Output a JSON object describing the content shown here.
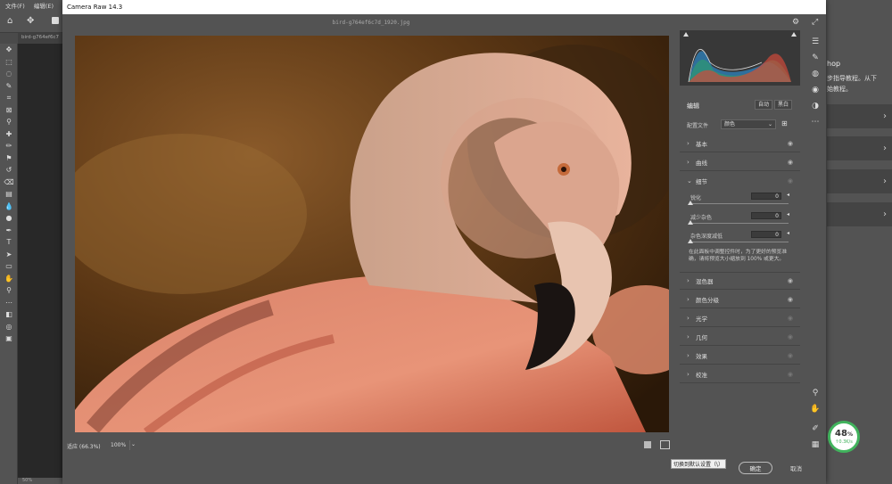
{
  "ps": {
    "menu": [
      "文件(F)",
      "编辑(E)"
    ],
    "tab_title": "bird-g764ef6c7",
    "status_zoom": "50%",
    "right_panel": {
      "title": "hop",
      "line1": "步指导教程。从下",
      "line2": "始教程。"
    }
  },
  "window": {
    "title": "Camera Raw 14.3",
    "filename": "bird-g764ef6c7d_1920.jpg"
  },
  "bottombar": {
    "fit_label": "适应 (66.3%)",
    "zoom_value": "100%"
  },
  "panel": {
    "edit_label": "编辑",
    "auto_label": "自动",
    "bw_label": "黑白",
    "profile_label": "配置文件",
    "profile_value": "颜色",
    "sections": [
      {
        "label": "基本",
        "expanded": false
      },
      {
        "label": "曲线",
        "expanded": false
      },
      {
        "label": "细节",
        "expanded": true
      },
      {
        "label": "混色器",
        "expanded": false
      },
      {
        "label": "颜色分级",
        "expanded": false
      },
      {
        "label": "光学",
        "expanded": false
      },
      {
        "label": "几何",
        "expanded": false
      },
      {
        "label": "效果",
        "expanded": false
      },
      {
        "label": "校准",
        "expanded": false
      }
    ],
    "detail": {
      "sharpen_label": "锐化",
      "sharpen_value": "0",
      "noise_label": "减少杂色",
      "noise_value": "0",
      "color_noise_label": "杂色深度减低",
      "color_noise_value": "0",
      "hint": "在此面板中调整控件时，为了更好的预览准确，请将预览大小缩放到 100% 或更大。"
    }
  },
  "footer": {
    "tooltip": "切换到默认设置（\\）",
    "ok_label": "确定",
    "cancel_label": "取消"
  },
  "zoom_badge": {
    "percent": "48",
    "unit": "%",
    "speed": "0.3K/s"
  },
  "colors": {
    "accent_green": "#41b35d"
  }
}
